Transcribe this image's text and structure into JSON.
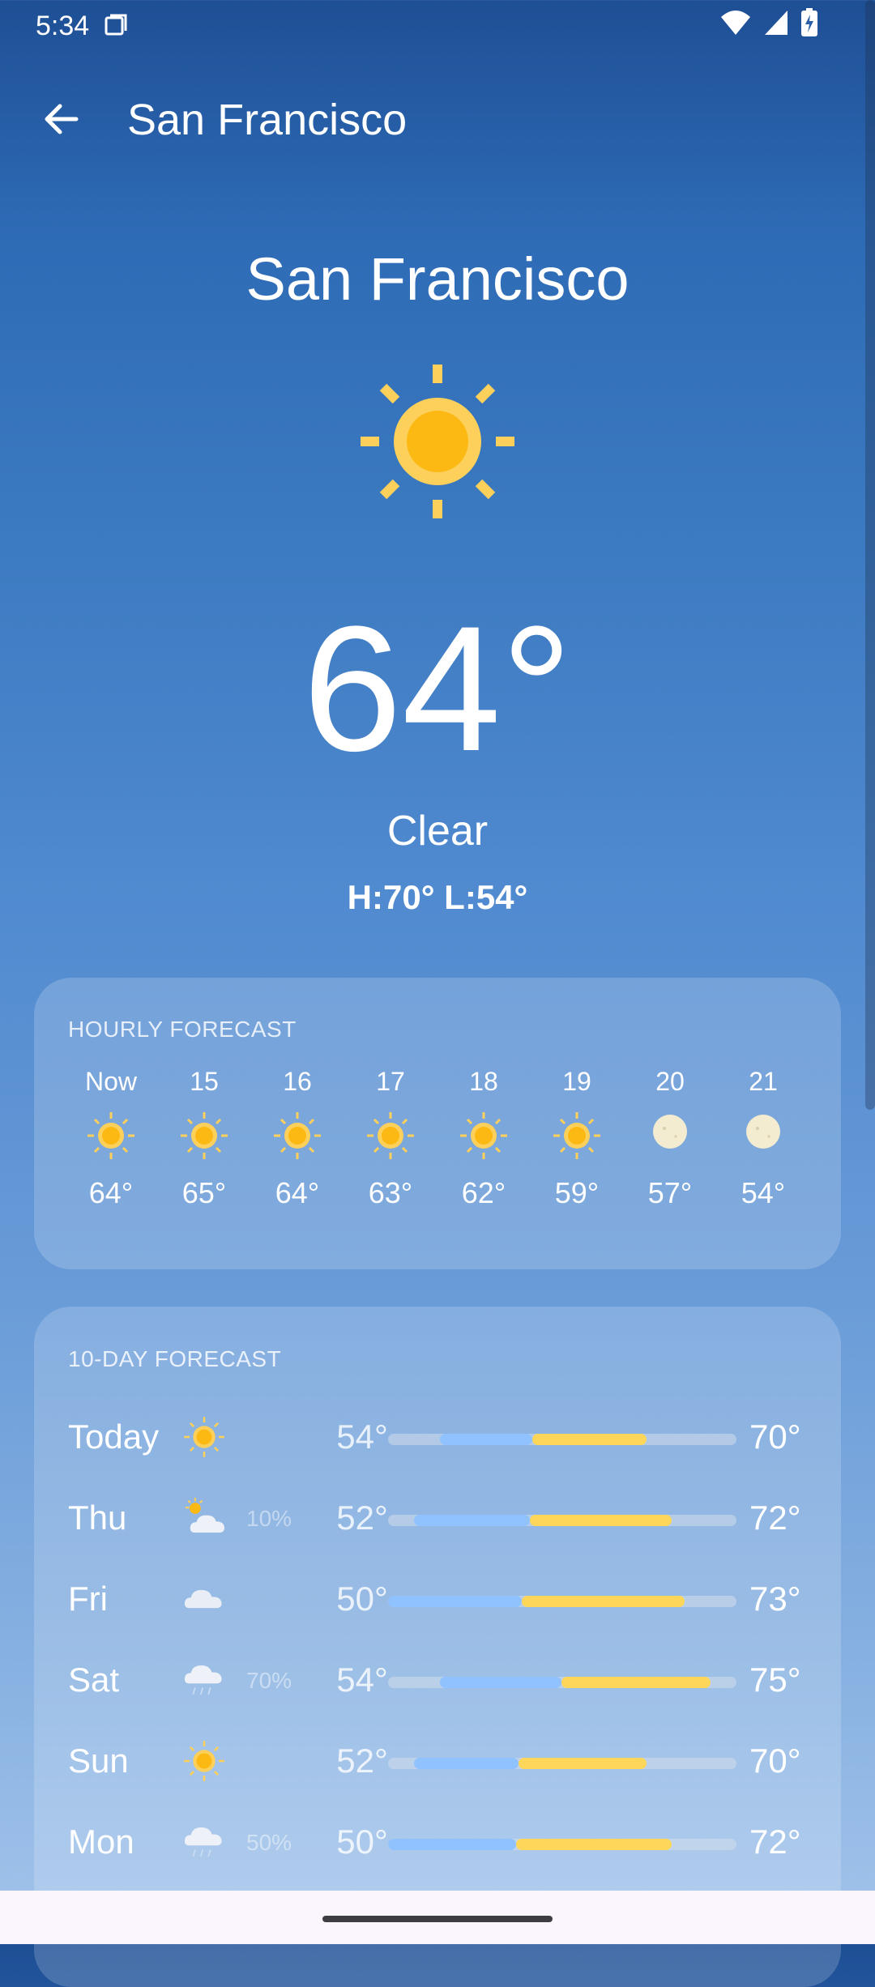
{
  "status": {
    "time": "5:34"
  },
  "appbar": {
    "title": "San Francisco"
  },
  "current": {
    "city": "San Francisco",
    "temperature": "64°",
    "condition": "Clear",
    "hilo": "H:70° L:54°",
    "icon": "sun-icon"
  },
  "hourly": {
    "title": "HOURLY FORECAST",
    "items": [
      {
        "label": "Now",
        "temp": "64°",
        "icon": "sun-icon"
      },
      {
        "label": "15",
        "temp": "65°",
        "icon": "sun-icon"
      },
      {
        "label": "16",
        "temp": "64°",
        "icon": "sun-icon"
      },
      {
        "label": "17",
        "temp": "63°",
        "icon": "sun-icon"
      },
      {
        "label": "18",
        "temp": "62°",
        "icon": "sun-icon"
      },
      {
        "label": "19",
        "temp": "59°",
        "icon": "sun-icon"
      },
      {
        "label": "20",
        "temp": "57°",
        "icon": "moon-icon"
      },
      {
        "label": "21",
        "temp": "54°",
        "icon": "moon-icon"
      }
    ]
  },
  "daily": {
    "title": "10-DAY FORECAST",
    "range_min": 50,
    "range_max": 77,
    "items": [
      {
        "day": "Today",
        "icon": "sun-icon",
        "precip": "",
        "low": "54°",
        "high": "70°",
        "low_val": 54,
        "high_val": 70
      },
      {
        "day": "Thu",
        "icon": "partly-cloudy-icon",
        "precip": "10%",
        "low": "52°",
        "high": "72°",
        "low_val": 52,
        "high_val": 72
      },
      {
        "day": "Fri",
        "icon": "cloud-icon",
        "precip": "",
        "low": "50°",
        "high": "73°",
        "low_val": 50,
        "high_val": 73
      },
      {
        "day": "Sat",
        "icon": "rain-icon",
        "precip": "70%",
        "low": "54°",
        "high": "75°",
        "low_val": 54,
        "high_val": 75
      },
      {
        "day": "Sun",
        "icon": "sun-icon",
        "precip": "",
        "low": "52°",
        "high": "70°",
        "low_val": 52,
        "high_val": 70
      },
      {
        "day": "Mon",
        "icon": "rain-icon",
        "precip": "50%",
        "low": "50°",
        "high": "72°",
        "low_val": 50,
        "high_val": 72
      }
    ]
  },
  "colors": {
    "sun": "#fdb913",
    "sun_ray": "#fcd05a",
    "moon": "#f3ecd0",
    "bar_cool": "#8fc2ff",
    "bar_warm": "#fdd65a"
  }
}
